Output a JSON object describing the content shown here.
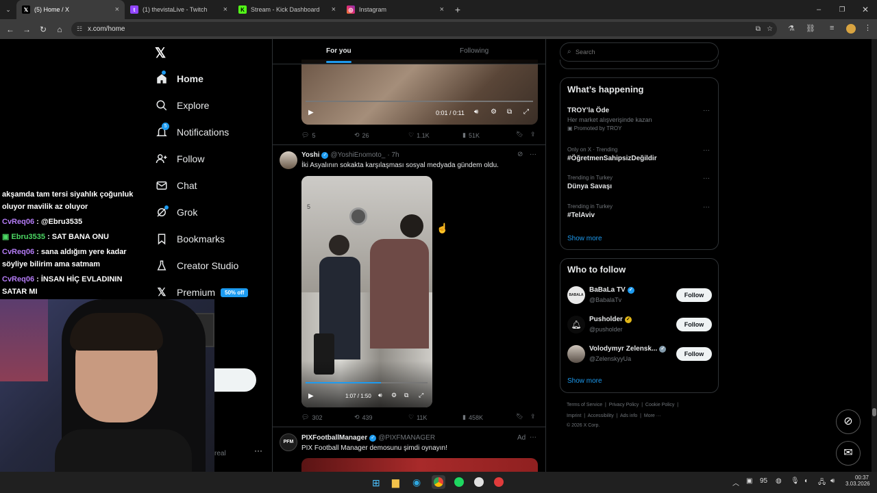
{
  "tabs": [
    {
      "title": "(5) Home / X",
      "icon": "x-icon",
      "color": "#000000"
    },
    {
      "title": "(1) thevistaLive - Twitch",
      "icon": "twitch-icon",
      "color": "#9146ff"
    },
    {
      "title": "Stream - Kick Dashboard",
      "icon": "kick-icon",
      "color": "#53fc18"
    },
    {
      "title": "Instagram",
      "icon": "instagram-icon",
      "color": "#e1306c"
    }
  ],
  "url": "x.com/home",
  "nav": [
    {
      "label": "Home",
      "icon": "home-icon"
    },
    {
      "label": "Explore",
      "icon": "search-icon"
    },
    {
      "label": "Notifications",
      "icon": "bell-icon"
    },
    {
      "label": "Follow",
      "icon": "add-user-icon"
    },
    {
      "label": "Chat",
      "icon": "mail-icon"
    },
    {
      "label": "Grok",
      "icon": "grok-icon"
    },
    {
      "label": "Bookmarks",
      "icon": "bookmark-icon"
    },
    {
      "label": "Creator Studio",
      "icon": "flask-icon"
    },
    {
      "label": "Premium",
      "icon": "x-icon"
    }
  ],
  "notif_count": "5",
  "premium_badge": "50% off",
  "feed_tabs": {
    "for_you": "For you",
    "following": "Following"
  },
  "post1": {
    "time": "0:01 / 0:11",
    "replies": "5",
    "reposts": "26",
    "likes": "1.1K",
    "views": "51K"
  },
  "post2": {
    "name": "Yoshi",
    "handle": "@YoshiEnomoto_",
    "age": "· 7h",
    "text": "İki Asyalının sokakta karşılaşması sosyal medyada gündem oldu.",
    "time": "1:07 / 1:50",
    "replies": "302",
    "reposts": "439",
    "likes": "11K",
    "views": "458K",
    "sign": "5"
  },
  "post3": {
    "name": "PIXFootballManager",
    "handle": "@PIXFMANAGER",
    "ad": "Ad",
    "text": "PIX Football Manager demosunu şimdi oynayın!",
    "avatar": "PFM"
  },
  "search": {
    "placeholder": "Search"
  },
  "happening": {
    "title": "What’s happening",
    "items": [
      {
        "meta": "",
        "title": "TROY’la Öde",
        "sub": "Her market alışverişinde kazan",
        "promo": "Promoted by TROY"
      },
      {
        "meta": "Only on X · Trending",
        "title": "#ÖğretmenSahipsizDeğildir"
      },
      {
        "meta": "Trending in Turkey",
        "title": "Dünya Savaşı"
      },
      {
        "meta": "Trending in Turkey",
        "title": "#TelAviv"
      }
    ],
    "show_more": "Show more"
  },
  "who_to_follow": {
    "title": "Who to follow",
    "items": [
      {
        "name": "BaBaLa TV",
        "handle": "@BabalaTv",
        "badge": "blue"
      },
      {
        "name": "Pusholder",
        "handle": "@pusholder",
        "badge": "gold"
      },
      {
        "name": "Volodymyr Zelensk...",
        "handle": "@ZelenskyyUa",
        "badge": "grey"
      }
    ],
    "button": "Follow",
    "show_more": "Show more"
  },
  "footer": {
    "row1": [
      "Terms of Service",
      "Privacy Policy",
      "Cookie Policy"
    ],
    "row2": [
      "Imprint",
      "Accessibility",
      "Ads info",
      "More ···"
    ],
    "copyright": "© 2026 X Corp."
  },
  "chat": [
    {
      "user": "",
      "msg": "akşamda tam tersi siyahlık çoğunluk oluyor mavilik az oluyor",
      "color": "#ffffff"
    },
    {
      "user": "CvReq06",
      "msg": ": @Ebru3535",
      "color": "#b57cf7"
    },
    {
      "user": "Ebru3535",
      "msg": ": SAT BANA ONU",
      "color": "#4cd964"
    },
    {
      "user": "CvReq06",
      "msg": ": sana aldığım yere kadar söyliye bilirim ama satmam",
      "color": "#b57cf7"
    },
    {
      "user": "CvReq06",
      "msg": ": İNSAN HİÇ EVLADININ SATAR MI",
      "color": "#b57cf7"
    }
  ],
  "leftover": "real",
  "taskbar": {
    "temp": "95",
    "time": "00:37",
    "date": "3.03.2026"
  }
}
